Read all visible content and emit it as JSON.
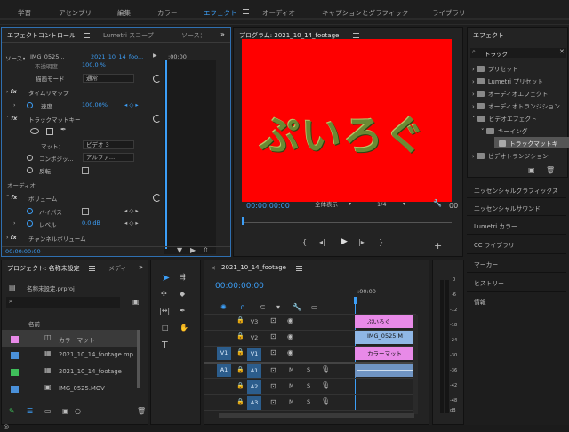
{
  "workspaces": [
    "学習",
    "アセンブリ",
    "編集",
    "カラー",
    "エフェクト",
    "オーディオ",
    "キャプションとグラフィック",
    "ライブラリ"
  ],
  "effect_controls": {
    "tab_label": "エフェクトコントロール",
    "tab2": "Lumetri スコープ",
    "tab3": "ソース：",
    "source_label": "ソース•",
    "source_clip": "IMG_0525...",
    "seq_clip": "2021_10_14_foo...",
    "tc_header": ":00:00",
    "rows": {
      "opacity_cut": "不透明度",
      "opacity_val": "100.0 %",
      "blend_mode": "描画モード",
      "blend_val": "通常",
      "time_remap": "タイムリマップ",
      "speed": "速度",
      "speed_val": "100.00%",
      "track_matte": "トラックマットキー",
      "matte": "マット：",
      "matte_val": "ビデオ 3",
      "composite": "コンポジッ...",
      "composite_val": "アルファ...",
      "invert": "反転",
      "audio": "オーディオ",
      "volume": "ボリューム",
      "bypass": "バイパス",
      "level": "レベル",
      "level_val": "0.0 dB",
      "channel_volume": "チャンネルボリューム"
    },
    "timecode": "00:00:00:00"
  },
  "program": {
    "title": "プログラム: 2021_10_14_footage",
    "overlay_text": "ぷいろぐ",
    "bg_color": "#ff0000",
    "timecode": "00:00:00:00",
    "fit": "全体表示",
    "quality": "1/4",
    "end_tc": "00"
  },
  "effects_panel": {
    "title": "エフェクト",
    "search": "トラック",
    "tree": [
      "プリセット",
      "Lumetri プリセット",
      "オーディオエフェクト",
      "オーディオトランジション",
      "ビデオエフェクト",
      "キーイング",
      "トラックマットキ",
      "ビデオトランジション"
    ],
    "side_items": [
      "エッセンシャルグラフィックス",
      "エッセンシャルサウンド",
      "Lumetri カラー",
      "CC ライブラリ",
      "マーカー",
      "ヒストリー",
      "情報"
    ]
  },
  "project": {
    "tab": "プロジェクト: 名称未設定",
    "tab2": "メディ",
    "file": "名称未設定.prproj",
    "header": "名前",
    "items": [
      {
        "name": "カラーマット",
        "color": "#e88ae8"
      },
      {
        "name": "2021_10_14_footage.mp",
        "color": "#4a90d9"
      },
      {
        "name": "2021_10_14_footage",
        "color": "#3fbf5a"
      },
      {
        "name": "IMG_0525.MOV",
        "color": "#4a90d9"
      }
    ]
  },
  "timeline": {
    "tab": "2021_10_14_footage",
    "timecode": "00:00:00:00",
    "ruler": ":00:00",
    "video_tracks": [
      "V3",
      "V2",
      "V1"
    ],
    "audio_tracks": [
      "A1",
      "A2",
      "A3"
    ],
    "src_v": "V1",
    "src_a": "A1",
    "clips": [
      {
        "label": "ぷいろぐ",
        "color": "#e88ae8"
      },
      {
        "label": "IMG_0525.M",
        "color": "#8fb7e6"
      },
      {
        "label": "カラーマット",
        "color": "#e88ae8"
      }
    ]
  },
  "meter": {
    "labels": [
      "0",
      "-6",
      "-12",
      "-18",
      "-24",
      "-30",
      "-36",
      "-42",
      "-48",
      "dB"
    ]
  }
}
